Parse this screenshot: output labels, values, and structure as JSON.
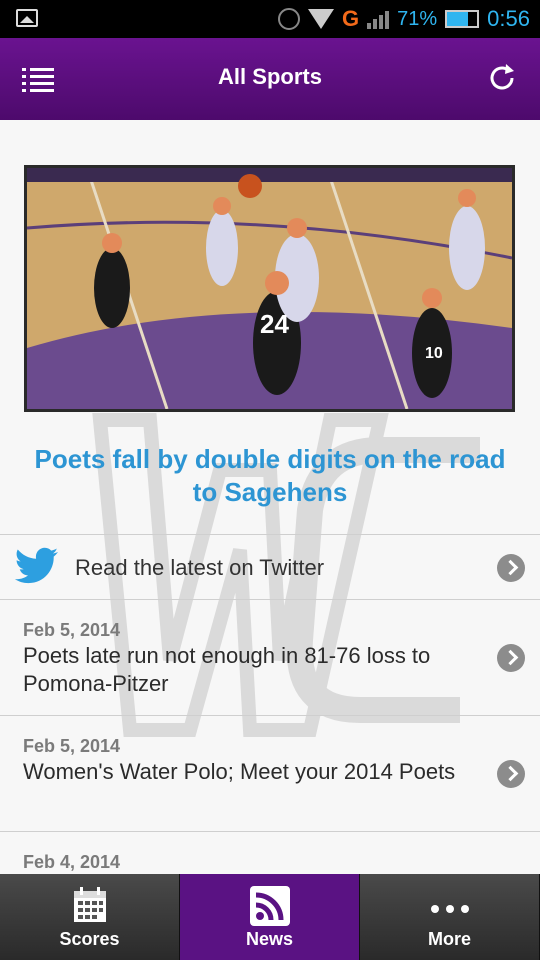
{
  "status_bar": {
    "network": "G",
    "battery": "71%",
    "time": "0:56"
  },
  "header": {
    "title": "All Sports"
  },
  "hero": {
    "headline": "Poets fall by double digits on the road to Sagehens",
    "jersey_numbers": [
      "24",
      "10"
    ]
  },
  "twitter": {
    "label": "Read the latest on Twitter"
  },
  "news": [
    {
      "date": "Feb 5, 2014",
      "title": "Poets late run not enough in 81-76 loss to Pomona-Pitzer"
    },
    {
      "date": "Feb 5, 2014",
      "title": "Women's Water Polo; Meet your 2014 Poets"
    },
    {
      "date": "Feb 4, 2014",
      "title": ""
    }
  ],
  "tabs": [
    {
      "label": "Scores",
      "icon": "calendar-icon"
    },
    {
      "label": "News",
      "icon": "rss-icon"
    },
    {
      "label": "More",
      "icon": "more-icon"
    }
  ],
  "colors": {
    "header_purple": "#5a1283",
    "headline_blue": "#2d95d3",
    "twitter_blue": "#2d9fe0"
  }
}
